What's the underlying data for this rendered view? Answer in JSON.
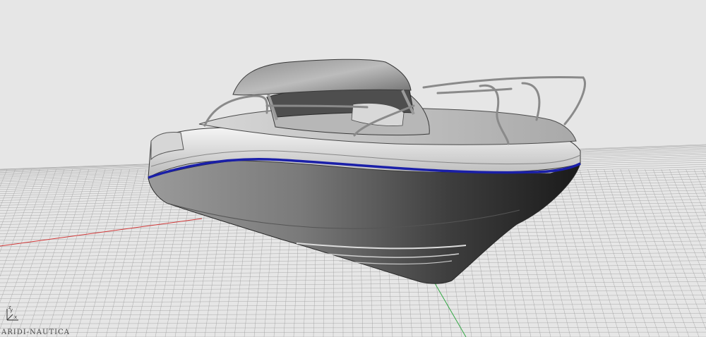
{
  "viewport": {
    "background": "#e6e6e6",
    "grid_color": "#9a9a9a",
    "x_axis_color": "#d23a3a",
    "y_axis_color": "#33a845",
    "trim_line_color": "#1a1fa8"
  },
  "axes_widget": {
    "x_label": "x",
    "y_label": "y",
    "z_label": "z"
  },
  "watermark": {
    "text": "ARIDI-NAUTICA"
  },
  "model": {
    "icon": "boat-render-icon"
  }
}
